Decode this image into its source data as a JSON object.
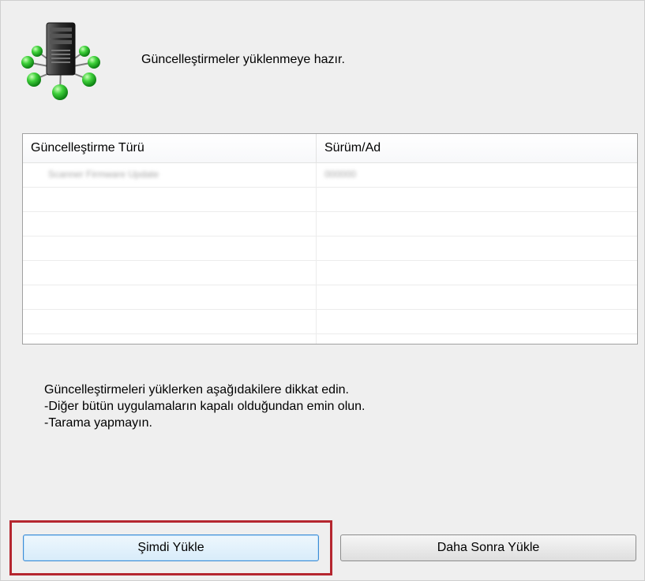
{
  "header": {
    "icon": "network-server-icon",
    "message": "Güncelleştirmeler yüklenmeye hazır."
  },
  "table": {
    "columns": [
      "Güncelleştirme Türü",
      "Sürüm/Ad"
    ],
    "rows": [
      [
        "Scanner Firmware Update",
        "000000"
      ],
      [
        "",
        ""
      ],
      [
        "",
        ""
      ],
      [
        "",
        ""
      ],
      [
        "",
        ""
      ],
      [
        "",
        ""
      ],
      [
        "",
        ""
      ],
      [
        "",
        ""
      ]
    ]
  },
  "notes": [
    "Güncelleştirmeleri yüklerken aşağıdakilere dikkat edin.",
    "-Diğer bütün uygulamaların kapalı olduğundan emin olun.",
    "-Tarama yapmayın."
  ],
  "buttons": {
    "install_now": "Şimdi Yükle",
    "install_later": "Daha Sonra Yükle"
  },
  "colors": {
    "highlight": "#b5262f",
    "primary_border": "#3c8cd6",
    "node_green": "#3fd13b"
  }
}
